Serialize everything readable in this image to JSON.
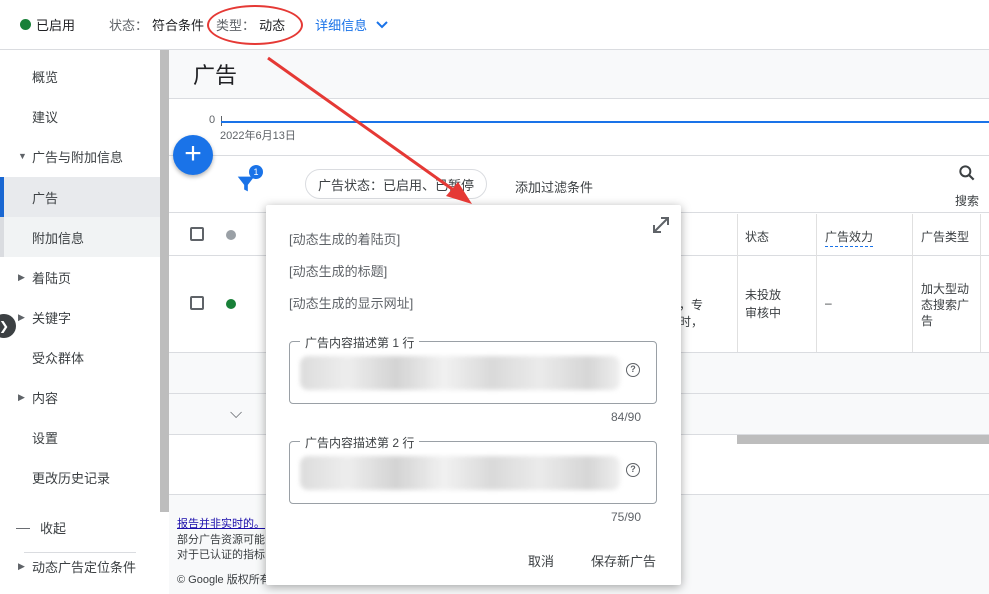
{
  "topbar": {
    "enabled": "已启用",
    "status_label": "状态：",
    "status_value": "符合条件",
    "type_label": "类型：",
    "type_value": "动态",
    "details": "详细信息"
  },
  "sidebar": {
    "items": [
      {
        "label": "概览"
      },
      {
        "label": "建议"
      },
      {
        "label": "广告与附加信息"
      },
      {
        "label": "广告"
      },
      {
        "label": "附加信息"
      },
      {
        "label": "着陆页"
      },
      {
        "label": "关键字"
      },
      {
        "label": "受众群体"
      },
      {
        "label": "内容"
      },
      {
        "label": "设置"
      },
      {
        "label": "更改历史记录"
      }
    ],
    "collapse": "收起",
    "dynamic_targets": "动态广告定位条件"
  },
  "main": {
    "title": "广告",
    "chart_zero": "0",
    "chart_date": "2022年6月13日"
  },
  "filter": {
    "badge": "1",
    "chip": "广告状态：已启用、已暂停",
    "add_filter": "添加过滤条件",
    "search": "搜索"
  },
  "table": {
    "headers": {
      "status": "状态",
      "effect": "广告效力",
      "type": "广告类型"
    },
    "row": {
      "ad_text_1": "，专",
      "ad_text_2": "时，",
      "status_1": "未投放",
      "status_2": "审核中",
      "effect": "–",
      "type_1": "加大型动",
      "type_2": "态搜索广",
      "type_3": "告"
    }
  },
  "footer": {
    "link": "报告并非实时的。",
    "line2": "部分广告资源可能",
    "line3": "对于已认证的指标",
    "copy": "© Google 版权所有"
  },
  "popup": {
    "landing": "[动态生成的着陆页]",
    "headline": "[动态生成的标题]",
    "display_url": "[动态生成的显示网址]",
    "desc1_label": "广告内容描述第 1 行",
    "desc1_count": "84/90",
    "desc2_label": "广告内容描述第 2 行",
    "desc2_count": "75/90",
    "cancel": "取消",
    "save": "保存新广告"
  },
  "colors": {
    "accent": "#1a73e8",
    "enabled_green": "#188038",
    "annotation_red": "#e53935"
  }
}
